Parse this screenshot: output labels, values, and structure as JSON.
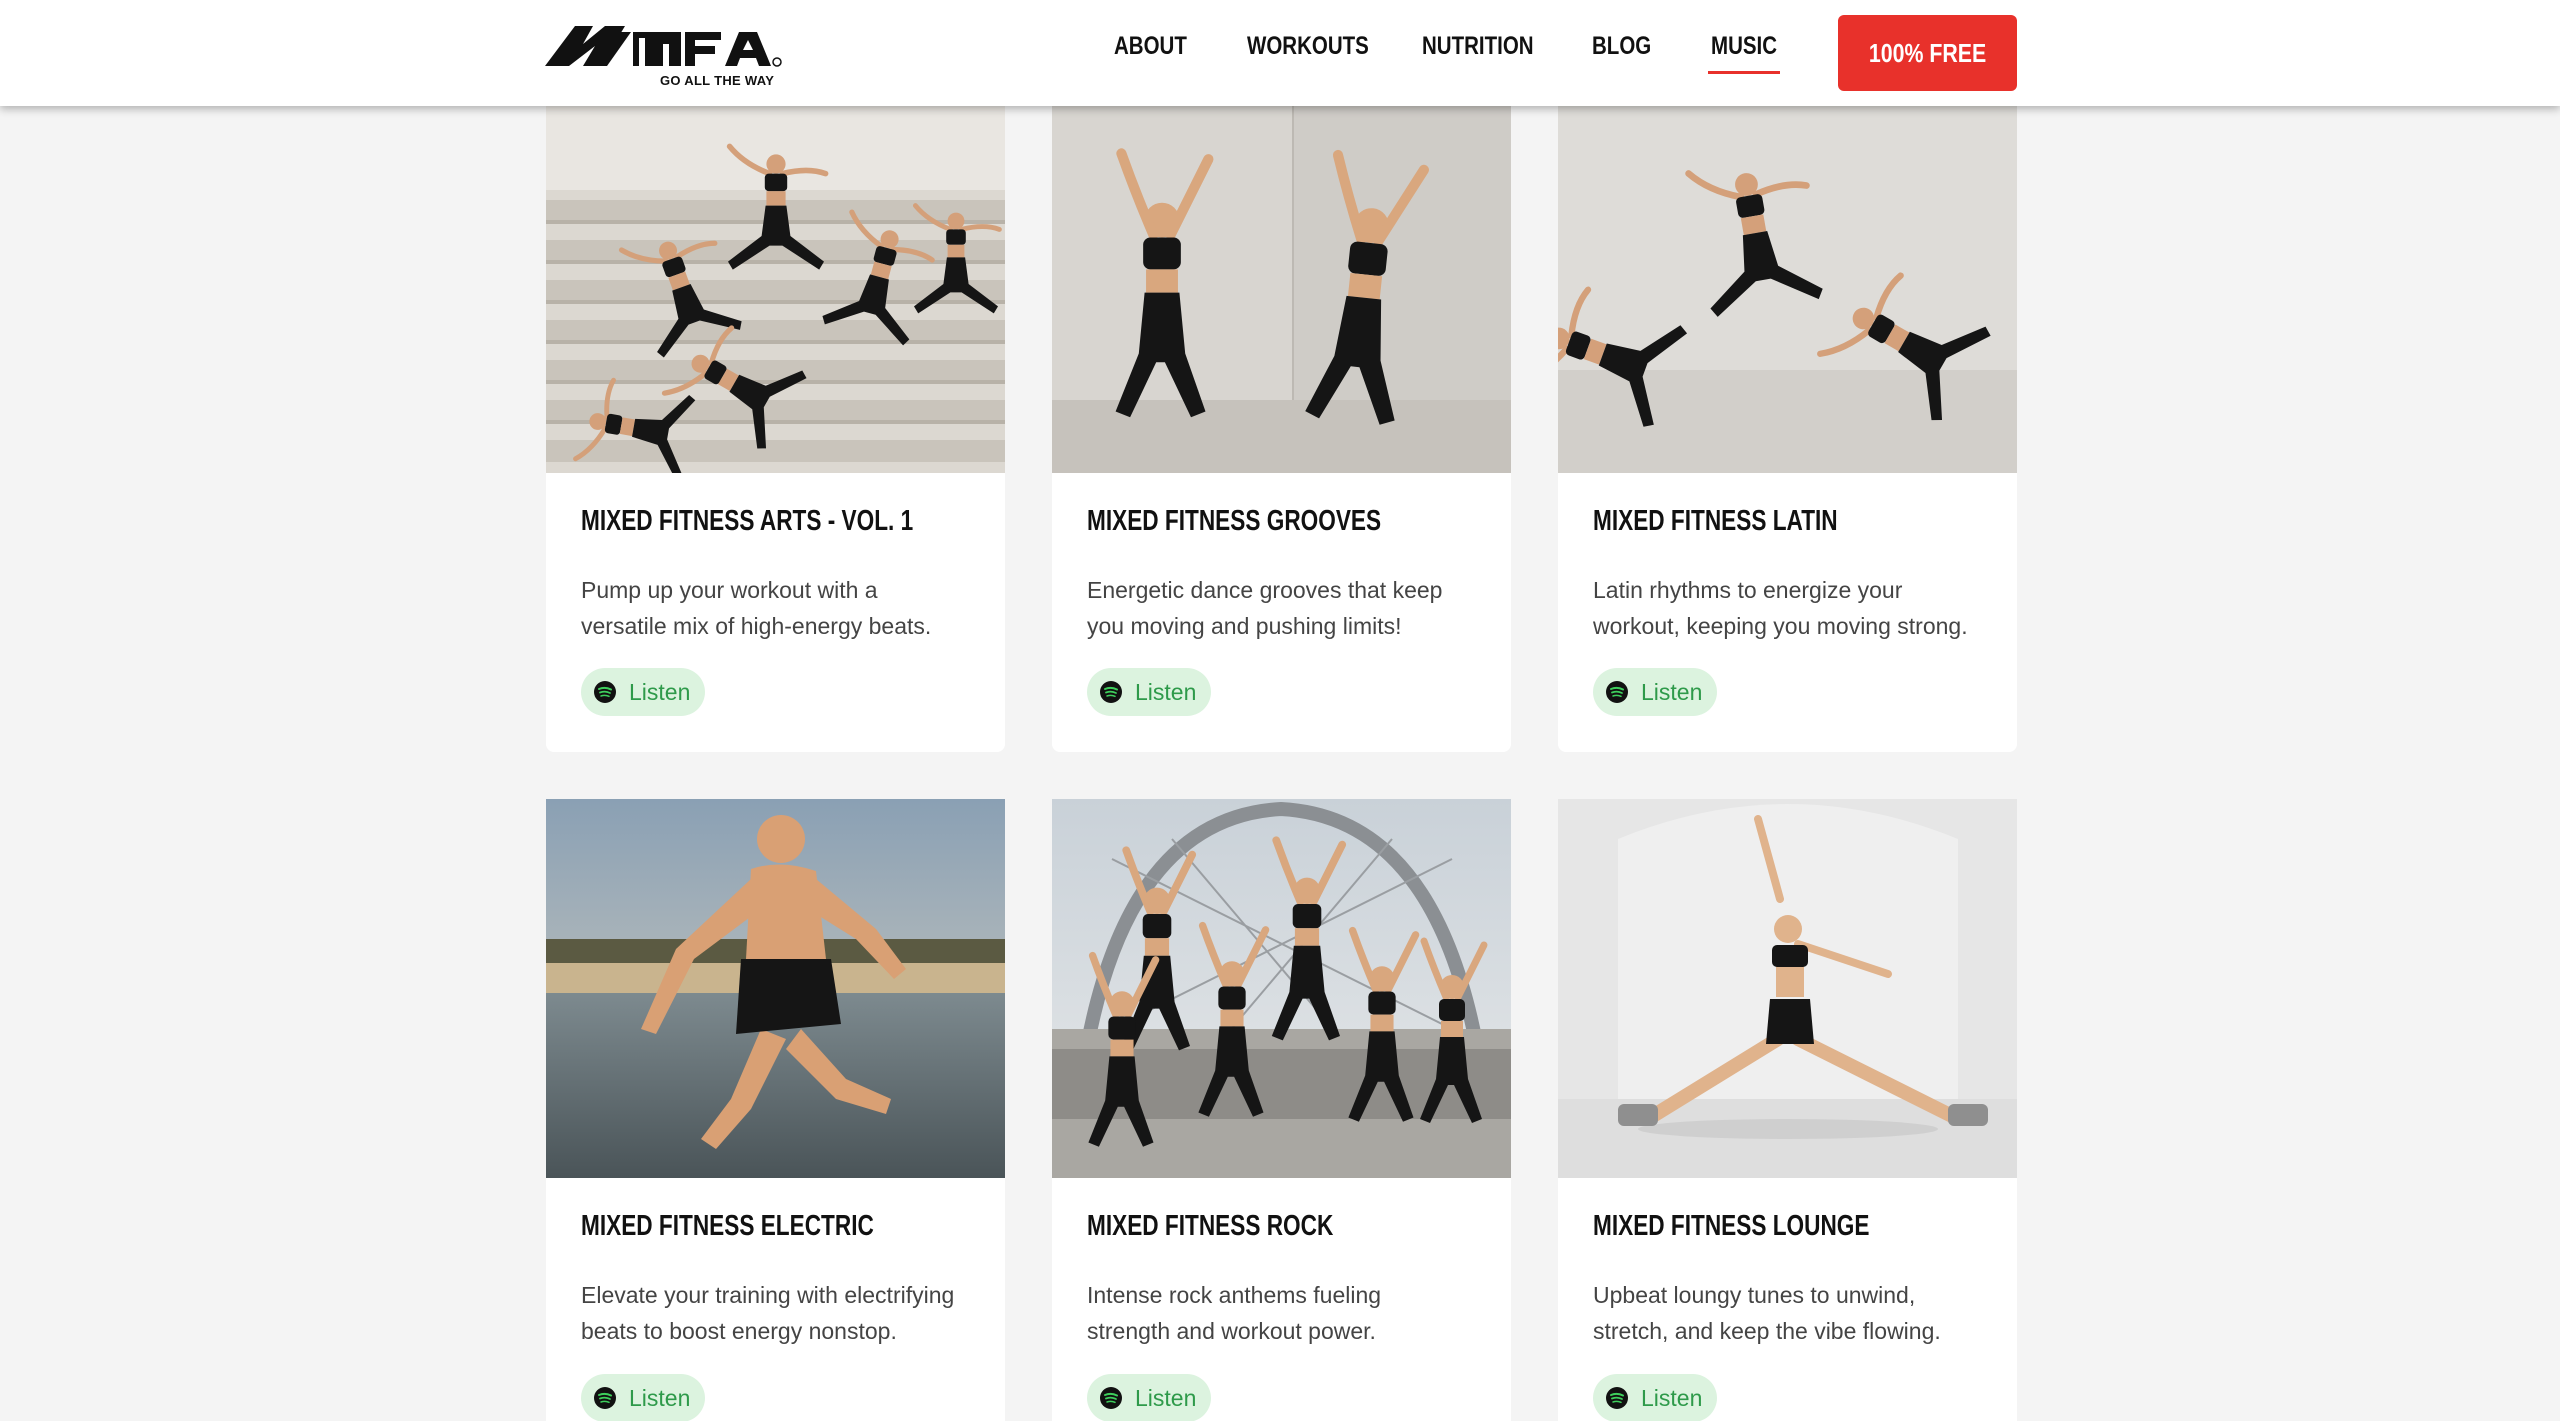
{
  "header": {
    "logo_text": "MFA",
    "tagline": "GO ALL THE WAY",
    "nav": [
      {
        "label": "ABOUT",
        "active": false
      },
      {
        "label": "WORKOUTS",
        "active": false
      },
      {
        "label": "NUTRITION",
        "active": false
      },
      {
        "label": "BLOG",
        "active": false
      },
      {
        "label": "MUSIC",
        "active": true
      }
    ],
    "cta_label": "100% FREE",
    "accent_color": "#e8312b"
  },
  "cards": [
    {
      "title": "MIXED FITNESS ARTS - VOL. 1",
      "desc_line1": "Pump up your workout with a",
      "desc_line2": "versatile mix of high-energy beats.",
      "listen_label": "Listen",
      "listen_icon": "spotify-icon"
    },
    {
      "title": "MIXED FITNESS GROOVES",
      "desc_line1": "Energetic dance grooves that keep",
      "desc_line2": "you moving and pushing limits!",
      "listen_label": "Listen",
      "listen_icon": "spotify-icon"
    },
    {
      "title": "MIXED FITNESS LATIN",
      "desc_line1": "Latin rhythms to energize your",
      "desc_line2": "workout, keeping you moving strong.",
      "listen_label": "Listen",
      "listen_icon": "spotify-icon"
    },
    {
      "title": "MIXED FITNESS ELECTRIC",
      "desc_line1": "Elevate your training with electrifying",
      "desc_line2": "beats to boost energy nonstop.",
      "listen_label": "Listen",
      "listen_icon": "spotify-icon"
    },
    {
      "title": "MIXED FITNESS ROCK",
      "desc_line1": "Intense rock anthems fueling",
      "desc_line2": "strength and workout power.",
      "listen_label": "Listen",
      "listen_icon": "spotify-icon"
    },
    {
      "title": "MIXED FITNESS LOUNGE",
      "desc_line1": "Upbeat loungy tunes to unwind,",
      "desc_line2": "stretch, and keep the vibe flowing.",
      "listen_label": "Listen",
      "listen_icon": "spotify-icon"
    }
  ],
  "listen_color": "#2e9a4a"
}
